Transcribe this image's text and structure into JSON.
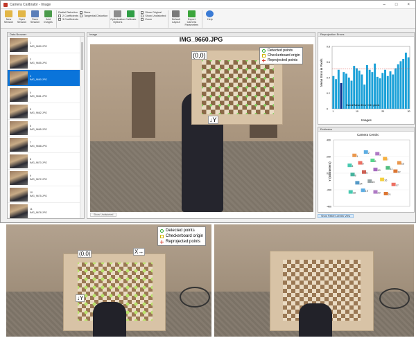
{
  "window": {
    "title": "Camera Calibrator - Image",
    "controls": [
      "–",
      "□",
      "×"
    ]
  },
  "toolstrip": {
    "groups": [
      {
        "buttons": [
          {
            "label": "New Session",
            "color": "#e2b646"
          },
          {
            "label": "Open Session",
            "color": "#e2b646"
          },
          {
            "label": "Save Session",
            "color": "#5b7fb9"
          },
          {
            "label": "Add Images",
            "color": "#4a9a4a"
          }
        ]
      },
      {
        "buttons": [
          {
            "label": "Default Layout",
            "color": "#8e8e8e"
          }
        ]
      },
      {
        "options": [
          "Radial Distortion",
          "2 Coefficients",
          "3 Coefficients",
          "Skew",
          "Tangential Distortion"
        ]
      },
      {
        "buttons": [
          {
            "label": "Optimization Options",
            "color": "#8d8d8d"
          },
          {
            "label": "Calibrate",
            "color": "#2f9e45"
          }
        ]
      },
      {
        "buttons": [
          {
            "label": "Show Original",
            "color": "#999"
          },
          {
            "label": "Show Undistorted",
            "color": "#999"
          },
          {
            "label": "Zoom",
            "color": "#999"
          }
        ]
      },
      {
        "buttons": [
          {
            "label": "Default Layout",
            "color": "#7a7a7a"
          },
          {
            "label": "Export Camera Parameters",
            "color": "#3ba53b"
          }
        ]
      },
      {
        "buttons": [
          {
            "label": "Help",
            "color": "#3a7bd5"
          }
        ]
      }
    ]
  },
  "data_browser": {
    "title": "Data Browser",
    "items": [
      {
        "n": "1",
        "name": "IMG_9650.JPG",
        "selected": false
      },
      {
        "n": "2",
        "name": "IMG_9655.JPG",
        "selected": false
      },
      {
        "n": "3",
        "name": "IMG_9660.JPG",
        "selected": true
      },
      {
        "n": "4",
        "name": "IMG_9661.JPG",
        "selected": false
      },
      {
        "n": "5",
        "name": "IMG_9662.JPG",
        "selected": false
      },
      {
        "n": "6",
        "name": "IMG_9665.JPG",
        "selected": false
      },
      {
        "n": "7",
        "name": "IMG_9668.JPG",
        "selected": false
      },
      {
        "n": "8",
        "name": "IMG_9670.JPG",
        "selected": false
      },
      {
        "n": "9",
        "name": "IMG_9672.JPG",
        "selected": false
      },
      {
        "n": "10",
        "name": "IMG_9675.JPG",
        "selected": false
      },
      {
        "n": "11",
        "name": "IMG_9678.JPG",
        "selected": false
      }
    ]
  },
  "main_view": {
    "tab": "Image",
    "image_title": "IMG_9660.JPG",
    "origin_label": "(0,0)",
    "y_label": "↓Y",
    "legend": [
      "Detected points",
      "Checkerboard origin",
      "Reprojected points"
    ],
    "bottom_tab": "Show Undistorted"
  },
  "reproj_panel": {
    "tab": "Reprojection Errors",
    "ylabel": "Mean Error in Pixels",
    "xlabel": "Images",
    "legend": "Overall Mean Error: 0.51 pixels"
  },
  "extrinsics_panel": {
    "tab": "Extrinsics",
    "title": "Camera Centric",
    "ylabel": "Y (millimeters)",
    "button": "Show Pattern-centric View"
  },
  "chart_data": [
    {
      "type": "bar",
      "title": "",
      "xlabel": "Images",
      "ylabel": "Mean Error in Pixels",
      "x": [
        1,
        2,
        3,
        4,
        5,
        6,
        7,
        8,
        9,
        10,
        11,
        12,
        13,
        14,
        15,
        16,
        17,
        18,
        19,
        20,
        21,
        22,
        23,
        24,
        25,
        26,
        27,
        28,
        29,
        30
      ],
      "values": [
        0.42,
        0.38,
        0.5,
        0.33,
        0.47,
        0.45,
        0.4,
        0.36,
        0.55,
        0.52,
        0.49,
        0.44,
        0.31,
        0.56,
        0.5,
        0.47,
        0.58,
        0.41,
        0.39,
        0.46,
        0.5,
        0.42,
        0.48,
        0.44,
        0.52,
        0.57,
        0.61,
        0.64,
        0.72,
        0.66
      ],
      "ylim": [
        0,
        0.8
      ],
      "series_colors": {
        "bars": "#1ba1d8",
        "selected": "#0d2e8c",
        "mean_line": "#d9534f"
      },
      "selected_index": 3,
      "overall_mean": 0.51,
      "legend": "Overall Mean Error: 0.51 pixels"
    },
    {
      "type": "scatter",
      "title": "Camera Centric",
      "ylabel": "Y (millimeters)",
      "xlim": [
        -400,
        400
      ],
      "ylim": [
        -400,
        400
      ],
      "points": [
        {
          "label": "1",
          "x": -180,
          "y": 210,
          "color": "#e67e22"
        },
        {
          "label": "2",
          "x": -60,
          "y": 250,
          "color": "#3498db"
        },
        {
          "label": "3",
          "x": 60,
          "y": 230,
          "color": "#9b59b6"
        },
        {
          "label": "4",
          "x": -230,
          "y": 90,
          "color": "#1abc9c"
        },
        {
          "label": "5",
          "x": -120,
          "y": 120,
          "color": "#e74c3c"
        },
        {
          "label": "6",
          "x": 10,
          "y": 150,
          "color": "#2ecc71"
        },
        {
          "label": "7",
          "x": 140,
          "y": 170,
          "color": "#f39c12"
        },
        {
          "label": "8",
          "x": -200,
          "y": -20,
          "color": "#16a085"
        },
        {
          "label": "9",
          "x": -80,
          "y": 10,
          "color": "#c0392b"
        },
        {
          "label": "10",
          "x": 40,
          "y": 40,
          "color": "#8e44ad"
        },
        {
          "label": "11",
          "x": 170,
          "y": 60,
          "color": "#27ae60"
        },
        {
          "label": "12",
          "x": 250,
          "y": 20,
          "color": "#d35400"
        },
        {
          "label": "13",
          "x": 290,
          "y": 120,
          "color": "#e67e22"
        },
        {
          "label": "14",
          "x": -150,
          "y": -120,
          "color": "#2980b9"
        },
        {
          "label": "15",
          "x": -20,
          "y": -100,
          "color": "#7f8c8d"
        },
        {
          "label": "16",
          "x": 110,
          "y": -80,
          "color": "#f1c40f"
        },
        {
          "label": "17",
          "x": 230,
          "y": -140,
          "color": "#e74c3c"
        },
        {
          "label": "18",
          "x": -220,
          "y": -230,
          "color": "#1abc9c"
        },
        {
          "label": "19",
          "x": -90,
          "y": -210,
          "color": "#3498db"
        },
        {
          "label": "20",
          "x": 40,
          "y": -230,
          "color": "#9b59b6"
        },
        {
          "label": "21",
          "x": 150,
          "y": -250,
          "color": "#d35400"
        }
      ],
      "yticks": [
        -400,
        -200,
        0,
        200,
        400
      ]
    }
  ],
  "bottom_left": {
    "origin_label": "(0,0)",
    "x_label": "X→",
    "y_label": "↓Y",
    "legend": [
      "Detected points",
      "Checkerboard origin",
      "Reprojected points"
    ]
  },
  "bottom_right": {}
}
